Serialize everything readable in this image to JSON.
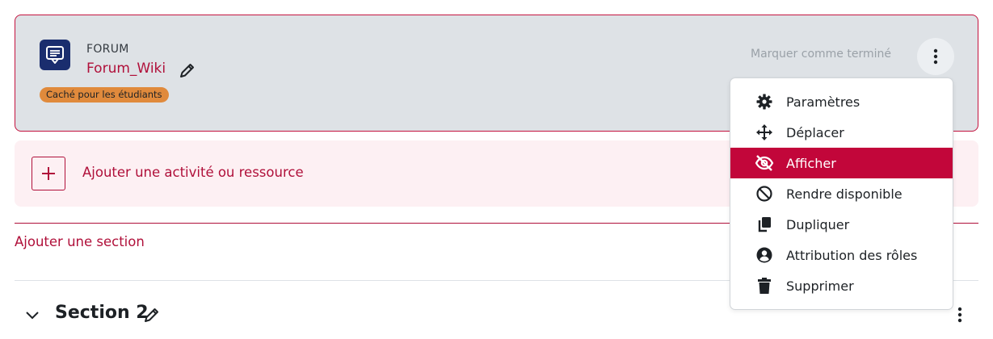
{
  "activity": {
    "type_label": "FORUM",
    "name": "Forum_Wiki",
    "badge": "Caché pour les étudiants",
    "mark_done": "Marquer comme terminé",
    "icon": "forum-icon"
  },
  "add_activity": {
    "label": "Ajouter une activité ou ressource"
  },
  "add_section": {
    "label": "Ajouter une section"
  },
  "section": {
    "title": "Section 2"
  },
  "menu": {
    "items": [
      {
        "label": "Paramètres",
        "icon": "gear-icon"
      },
      {
        "label": "Déplacer",
        "icon": "move-icon"
      },
      {
        "label": "Afficher",
        "icon": "eye-slash-icon",
        "active": true
      },
      {
        "label": "Rendre disponible",
        "icon": "ban-icon"
      },
      {
        "label": "Dupliquer",
        "icon": "copy-icon"
      },
      {
        "label": "Attribution des rôles",
        "icon": "user-circle-icon"
      },
      {
        "label": "Supprimer",
        "icon": "trash-icon"
      }
    ]
  },
  "colors": {
    "accent": "#b0103a",
    "active_item": "#c2063a",
    "card_bg": "#dee2e6",
    "badge": "#e08a3c",
    "forum_icon_bg": "#1a2d6e"
  }
}
